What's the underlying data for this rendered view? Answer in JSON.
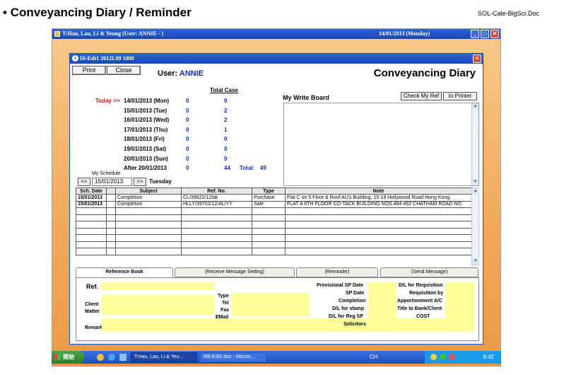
{
  "doc": {
    "heading": "Conveyancing Diary / Reminder",
    "filename": "SOL-Cale-BigScr.Doc"
  },
  "app": {
    "title": "T:Hau, Lau, Li & Yeung  (User: ANNIE - )",
    "date": "14/01/2013  (Monday)",
    "min": "_",
    "max": "□",
    "close": "✕"
  },
  "dialog": {
    "title": "Di-Edt1 2012L09 1000",
    "print": "Print",
    "close": "Close",
    "user_label": "User:",
    "user": "ANNIE",
    "heading": "Conveyancing Diary"
  },
  "schedule": {
    "total_case_label": "Total Case",
    "today_marker": "Today >>",
    "rows": [
      {
        "date": "14/01/2013 (Mon)",
        "a": "0",
        "b": "0"
      },
      {
        "date": "15/01/2013 (Tue)",
        "a": "0",
        "b": "2"
      },
      {
        "date": "16/01/2013 (Wed)",
        "a": "0",
        "b": "2"
      },
      {
        "date": "17/01/2013 (Thu)",
        "a": "0",
        "b": "1"
      },
      {
        "date": "18/01/2013 (Fri)",
        "a": "0",
        "b": "0"
      },
      {
        "date": "19/01/2013 (Sat)",
        "a": "0",
        "b": "0"
      },
      {
        "date": "20/01/2013 (Sun)",
        "a": "0",
        "b": "0"
      },
      {
        "date": "After 20/01/2013",
        "a": "0",
        "b": "44"
      }
    ],
    "total_label": "Total:",
    "total": "49",
    "my_schedule_label": "My Schedule",
    "prev": "<<",
    "next": ">>",
    "date_value": "15/01/2013",
    "weekday": "Tuesday"
  },
  "write_board": {
    "label": "My Write Board",
    "check_ref": "Check My Ref",
    "to_printer": "to Printer"
  },
  "table": {
    "headers": [
      "Sch. Date",
      "",
      "Subject",
      "Ref. No.",
      "Type",
      "Note"
    ],
    "rows": [
      [
        "15/01/2013",
        "",
        "Completion",
        "CL/39622/12/ak",
        "Purchase",
        "Flat C on 5 Floor & Roof AU's Building, 15-19 Hollywood Road Hong Kong."
      ],
      [
        "15/01/2013",
        "",
        "Completion",
        "HLLY/39702/12/AL/YY",
        "Sale",
        "FLAT A 6TH FLOOR CO-TACK BUILDING NOS.484-492 CHATHAM ROAD NO"
      ]
    ],
    "empty_rows": 7
  },
  "tabs": [
    "Reference Book",
    "(Receive Message Setting)",
    "(Reminder)",
    "(Send Message)"
  ],
  "ref": {
    "ref": "Ref.",
    "client": "Client",
    "matter": "Matter",
    "remark": "Remark",
    "type": "Type",
    "tel": "Tel",
    "fax": "Fax",
    "email": "EMail",
    "prov_sp": "Provisional SP Date",
    "sp_date": "SP Date",
    "completion": "Completion",
    "dl_stamp": "D/L for stamp",
    "dl_reg": "D/L for Reg SP",
    "solicitors": "Solicitors",
    "dl_req": "D/L for Requisition",
    "req_by": "Requisition by",
    "apport": "Apportionment A/C",
    "title_bank": "Title to Bank/Client",
    "cost": "COST"
  },
  "taskbar": {
    "start": "開始",
    "task1": "T:Hau, Lau, Li & Yeu...",
    "task2": "RB-Edt2.doc - Micros...",
    "lang": "CH",
    "time": "9:42"
  }
}
